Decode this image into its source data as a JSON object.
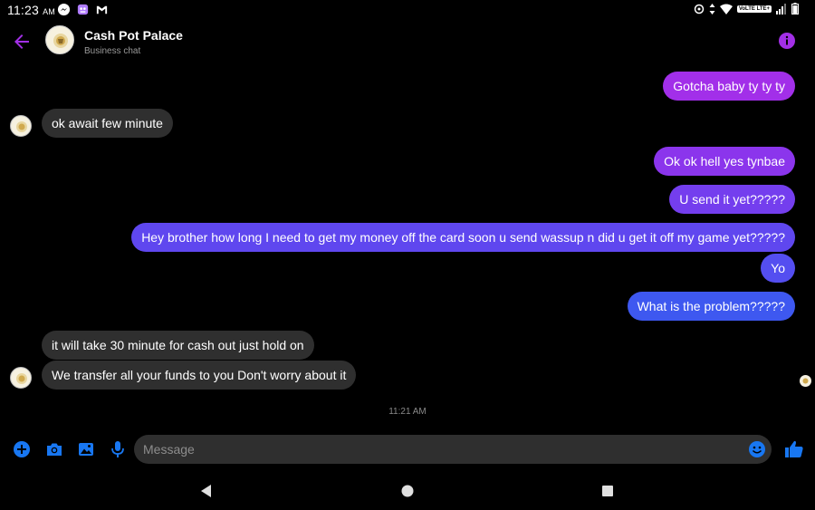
{
  "status_bar": {
    "time": "11:23",
    "ampm": "AM",
    "icons_left": [
      "messenger-icon",
      "app-icon",
      "gmail-icon"
    ],
    "icons_right": [
      "data-saver-icon",
      "data-arrows-icon",
      "wifi-icon",
      "volte-icon",
      "signal-icon",
      "battery-icon"
    ],
    "volte_label": "VoLTE LTE+"
  },
  "header": {
    "title": "Cash Pot Palace",
    "subtitle": "Business chat"
  },
  "colors": {
    "accent_purple": "#a22fe6",
    "bubble_grad_top": "#a12fe8",
    "bubble_grad_bottom": "#3e58f0",
    "incoming_bubble": "#2f2f2f",
    "icon_blue": "#1877f2"
  },
  "messages": [
    {
      "id": "m1",
      "direction": "out",
      "text": "Gotcha baby ty ty ty"
    },
    {
      "id": "m2",
      "direction": "in",
      "text": "ok await few minute"
    },
    {
      "id": "m3",
      "direction": "out",
      "text": "Ok ok hell yes tynbae"
    },
    {
      "id": "m4",
      "direction": "out",
      "text": "U send it yet?????"
    },
    {
      "id": "m5",
      "direction": "out",
      "text": "Hey brother how long I need to get my money off the card soon u send wassup n did u get it off my game yet?????"
    },
    {
      "id": "m6",
      "direction": "out",
      "text": "Yo"
    },
    {
      "id": "m7",
      "direction": "out",
      "text": "What is the problem?????"
    },
    {
      "id": "m8",
      "direction": "in",
      "text": "it will take 30 minute for cash out just hold on"
    },
    {
      "id": "m9",
      "direction": "in",
      "text": "We transfer all your funds  to you Don't worry about it"
    }
  ],
  "timestamp": "11:21 AM",
  "composer": {
    "placeholder": "Message",
    "icons": [
      "add-icon",
      "camera-icon",
      "gallery-icon",
      "microphone-icon",
      "emoji-icon",
      "thumbs-up-icon"
    ]
  },
  "nav": {
    "buttons": [
      "back-nav-icon",
      "home-nav-icon",
      "recents-nav-icon"
    ]
  }
}
